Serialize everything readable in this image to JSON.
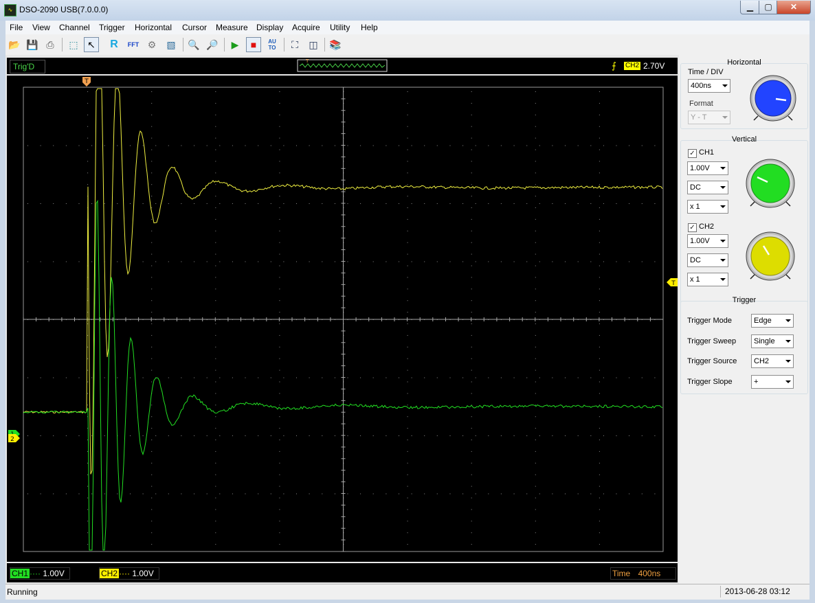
{
  "window": {
    "title": "DSO-2090 USB(7.0.0.0)"
  },
  "menu": [
    "File",
    "View",
    "Channel",
    "Trigger",
    "Horizontal",
    "Cursor",
    "Measure",
    "Display",
    "Acquire",
    "Utility",
    "Help"
  ],
  "toolbar": {
    "icons": [
      "open-icon",
      "save-icon",
      "print-icon",
      "select-cursor-icon",
      "pointer-icon",
      "reference-icon",
      "fft-icon",
      "math-icon",
      "persist-icon",
      "zoom-in-icon",
      "zoom-out-icon",
      "run-icon",
      "stop-icon",
      "auto-icon",
      "fullscreen-icon",
      "panel-icon",
      "book-icon"
    ],
    "r_label": "R",
    "fft_label": "FFT",
    "auto_label": "AU\nTO"
  },
  "scope": {
    "trig_status": "Trig'D",
    "trigger_source_tag": "CH2",
    "trigger_level": "2.70V",
    "trigger_marker_label": "T",
    "ch1_marker": "1",
    "ch2_marker": "2",
    "colors": {
      "ch1": "#22e022",
      "ch2": "#f0f040",
      "grid": "#8a8a8a",
      "trigger": "#ffff00"
    },
    "bottom": {
      "ch1_label": "CH1",
      "ch1_value": "1.00V",
      "ch2_label": "CH2",
      "ch2_value": "1.00V",
      "time_label": "Time",
      "time_value": "400ns"
    }
  },
  "panel": {
    "horizontal": {
      "title": "Horizontal",
      "time_div_label": "Time / DIV",
      "time_div_value": "400ns",
      "format_label": "Format",
      "format_value": "Y - T",
      "knob_color": "#2244ff"
    },
    "vertical": {
      "title": "Vertical",
      "ch1": {
        "label": "CH1",
        "volts": "1.00V",
        "coupling": "DC",
        "probe": "x 1",
        "knob_color": "#22dd22"
      },
      "ch2": {
        "label": "CH2",
        "volts": "1.00V",
        "coupling": "DC",
        "probe": "x 1",
        "knob_color": "#dddd00"
      }
    },
    "trigger": {
      "title": "Trigger",
      "mode_label": "Trigger Mode",
      "mode_value": "Edge",
      "sweep_label": "Trigger Sweep",
      "sweep_value": "Single",
      "source_label": "Trigger Source",
      "source_value": "CH2",
      "slope_label": "Trigger Slope",
      "slope_value": "+"
    }
  },
  "status": {
    "left": "Running",
    "datetime": "2013-06-28  03:12"
  }
}
